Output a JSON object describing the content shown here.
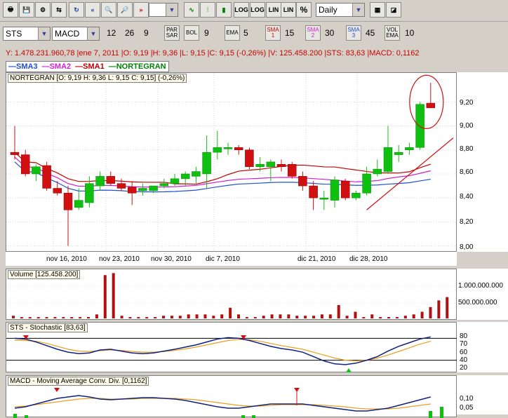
{
  "toolbar": {
    "period": "Daily",
    "buttons": [
      "LOG",
      "LOG",
      "LIN",
      "LIN",
      "%"
    ]
  },
  "indicators_bar": {
    "symbol": "STS",
    "indicator": "MACD",
    "macd_fast": "12",
    "macd_slow": "26",
    "macd_signal": "9",
    "parsar_label": "PAR SAR",
    "bol_label": "BOL",
    "bol_value": "9",
    "ema_label": "EMA",
    "ema_value": "5",
    "sma1_label": "SMA 1",
    "sma1_value": "15",
    "sma2_label": "SMA 2",
    "sma2_value": "30",
    "sma3_label": "SMA 3",
    "sma3_value": "45",
    "volema_label": "VOL EMA",
    "volema_value": "10"
  },
  "infoline": "Y: 1.478.231.960,78 |ene 7, 2011 |O: 9,19 |H: 9,36 |L: 9,15 |C: 9,15 (-0,26%) |V: 125.458.200 |STS: 83,63 |MACD: 0,1162",
  "legend": [
    {
      "label": "SMA3",
      "color": "#1f4fd0"
    },
    {
      "label": "SMA2",
      "color": "#d020d0"
    },
    {
      "label": "SMA1",
      "color": "#c00000"
    },
    {
      "label": "NORTEGRAN",
      "color": "#008000"
    }
  ],
  "price_panel": {
    "title": "NORTEGRAN [O: 9,19  H: 9,36  L: 9,15  C: 9,15] (-0,26%)",
    "y_ticks": [
      "9,20",
      "9,00",
      "8,80",
      "8,60",
      "8,40",
      "8,20",
      "8,00"
    ],
    "x_labels": [
      "nov 16, 2010",
      "nov 23, 2010",
      "nov 30, 2010",
      "dic 7, 2010",
      "dic 21, 2010",
      "dic 28, 2010"
    ]
  },
  "volume_panel": {
    "title": "Volume [125.458.200]",
    "y_ticks": [
      "1.000.000.000",
      "500.000.000"
    ]
  },
  "sts_panel": {
    "title": "STS - Stochastic [83,63]",
    "y_ticks": [
      "80",
      "70",
      "60",
      "40",
      "20"
    ]
  },
  "macd_panel": {
    "title": "MACD - Moving Average Conv. Div. [0,1162]",
    "y_ticks": [
      "0,10",
      "0,05"
    ]
  },
  "chart_data": {
    "type": "candlestick",
    "ylim": [
      7.98,
      9.43
    ],
    "candles": [
      {
        "o": 8.78,
        "h": 9.0,
        "l": 8.72,
        "c": 8.76
      },
      {
        "o": 8.76,
        "h": 8.8,
        "l": 8.58,
        "c": 8.6
      },
      {
        "o": 8.6,
        "h": 8.68,
        "l": 8.54,
        "c": 8.66
      },
      {
        "o": 8.67,
        "h": 8.7,
        "l": 8.46,
        "c": 8.48
      },
      {
        "o": 8.48,
        "h": 8.54,
        "l": 8.42,
        "c": 8.44
      },
      {
        "o": 8.44,
        "h": 8.5,
        "l": 8.0,
        "c": 8.3
      },
      {
        "o": 8.32,
        "h": 8.48,
        "l": 8.3,
        "c": 8.38
      },
      {
        "o": 8.36,
        "h": 8.58,
        "l": 8.32,
        "c": 8.52
      },
      {
        "o": 8.5,
        "h": 8.62,
        "l": 8.46,
        "c": 8.58
      },
      {
        "o": 8.58,
        "h": 8.62,
        "l": 8.5,
        "c": 8.52
      },
      {
        "o": 8.52,
        "h": 8.56,
        "l": 8.46,
        "c": 8.48
      },
      {
        "o": 8.49,
        "h": 8.54,
        "l": 8.34,
        "c": 8.44
      },
      {
        "o": 8.46,
        "h": 8.52,
        "l": 8.42,
        "c": 8.48
      },
      {
        "o": 8.46,
        "h": 8.5,
        "l": 8.44,
        "c": 8.5
      },
      {
        "o": 8.5,
        "h": 8.56,
        "l": 8.48,
        "c": 8.52
      },
      {
        "o": 8.52,
        "h": 8.6,
        "l": 8.5,
        "c": 8.56
      },
      {
        "o": 8.56,
        "h": 8.62,
        "l": 8.5,
        "c": 8.6
      },
      {
        "o": 8.58,
        "h": 8.66,
        "l": 8.52,
        "c": 8.62
      },
      {
        "o": 8.6,
        "h": 8.92,
        "l": 8.48,
        "c": 8.78
      },
      {
        "o": 8.78,
        "h": 8.96,
        "l": 8.72,
        "c": 8.82
      },
      {
        "o": 8.82,
        "h": 8.86,
        "l": 8.76,
        "c": 8.82
      },
      {
        "o": 8.82,
        "h": 8.84,
        "l": 8.76,
        "c": 8.8
      },
      {
        "o": 8.8,
        "h": 8.82,
        "l": 8.64,
        "c": 8.66
      },
      {
        "o": 8.66,
        "h": 8.74,
        "l": 8.62,
        "c": 8.68
      },
      {
        "o": 8.66,
        "h": 8.72,
        "l": 8.54,
        "c": 8.7
      },
      {
        "o": 8.68,
        "h": 8.72,
        "l": 8.62,
        "c": 8.66
      },
      {
        "o": 8.68,
        "h": 8.7,
        "l": 8.56,
        "c": 8.58
      },
      {
        "o": 8.58,
        "h": 8.62,
        "l": 8.46,
        "c": 8.5
      },
      {
        "o": 8.5,
        "h": 8.54,
        "l": 8.3,
        "c": 8.4
      },
      {
        "o": 8.4,
        "h": 8.46,
        "l": 8.3,
        "c": 8.4
      },
      {
        "o": 8.38,
        "h": 8.58,
        "l": 8.32,
        "c": 8.55
      },
      {
        "o": 8.54,
        "h": 8.56,
        "l": 8.38,
        "c": 8.4
      },
      {
        "o": 8.4,
        "h": 8.46,
        "l": 8.38,
        "c": 8.44
      },
      {
        "o": 8.44,
        "h": 8.66,
        "l": 8.42,
        "c": 8.6
      },
      {
        "o": 8.6,
        "h": 8.72,
        "l": 8.58,
        "c": 8.64
      },
      {
        "o": 8.62,
        "h": 9.0,
        "l": 8.6,
        "c": 8.82
      },
      {
        "o": 8.76,
        "h": 8.84,
        "l": 8.7,
        "c": 8.78
      },
      {
        "o": 8.8,
        "h": 8.86,
        "l": 8.76,
        "c": 8.82
      },
      {
        "o": 8.82,
        "h": 9.2,
        "l": 8.8,
        "c": 9.18
      },
      {
        "o": 9.19,
        "h": 9.36,
        "l": 9.15,
        "c": 9.15
      }
    ],
    "volume": [
      40,
      20,
      20,
      20,
      20,
      20,
      20,
      20,
      20,
      20,
      60,
      650,
      680,
      40,
      20,
      20,
      20,
      20,
      40,
      40,
      40,
      60,
      60,
      60,
      40,
      60,
      160,
      60,
      20,
      20,
      40,
      60,
      60,
      60,
      40,
      40,
      40,
      60,
      60,
      200,
      40,
      100,
      20,
      60,
      20,
      20,
      20,
      40,
      60,
      100,
      170,
      270,
      320
    ],
    "volume_max_label": 1000000000
  }
}
